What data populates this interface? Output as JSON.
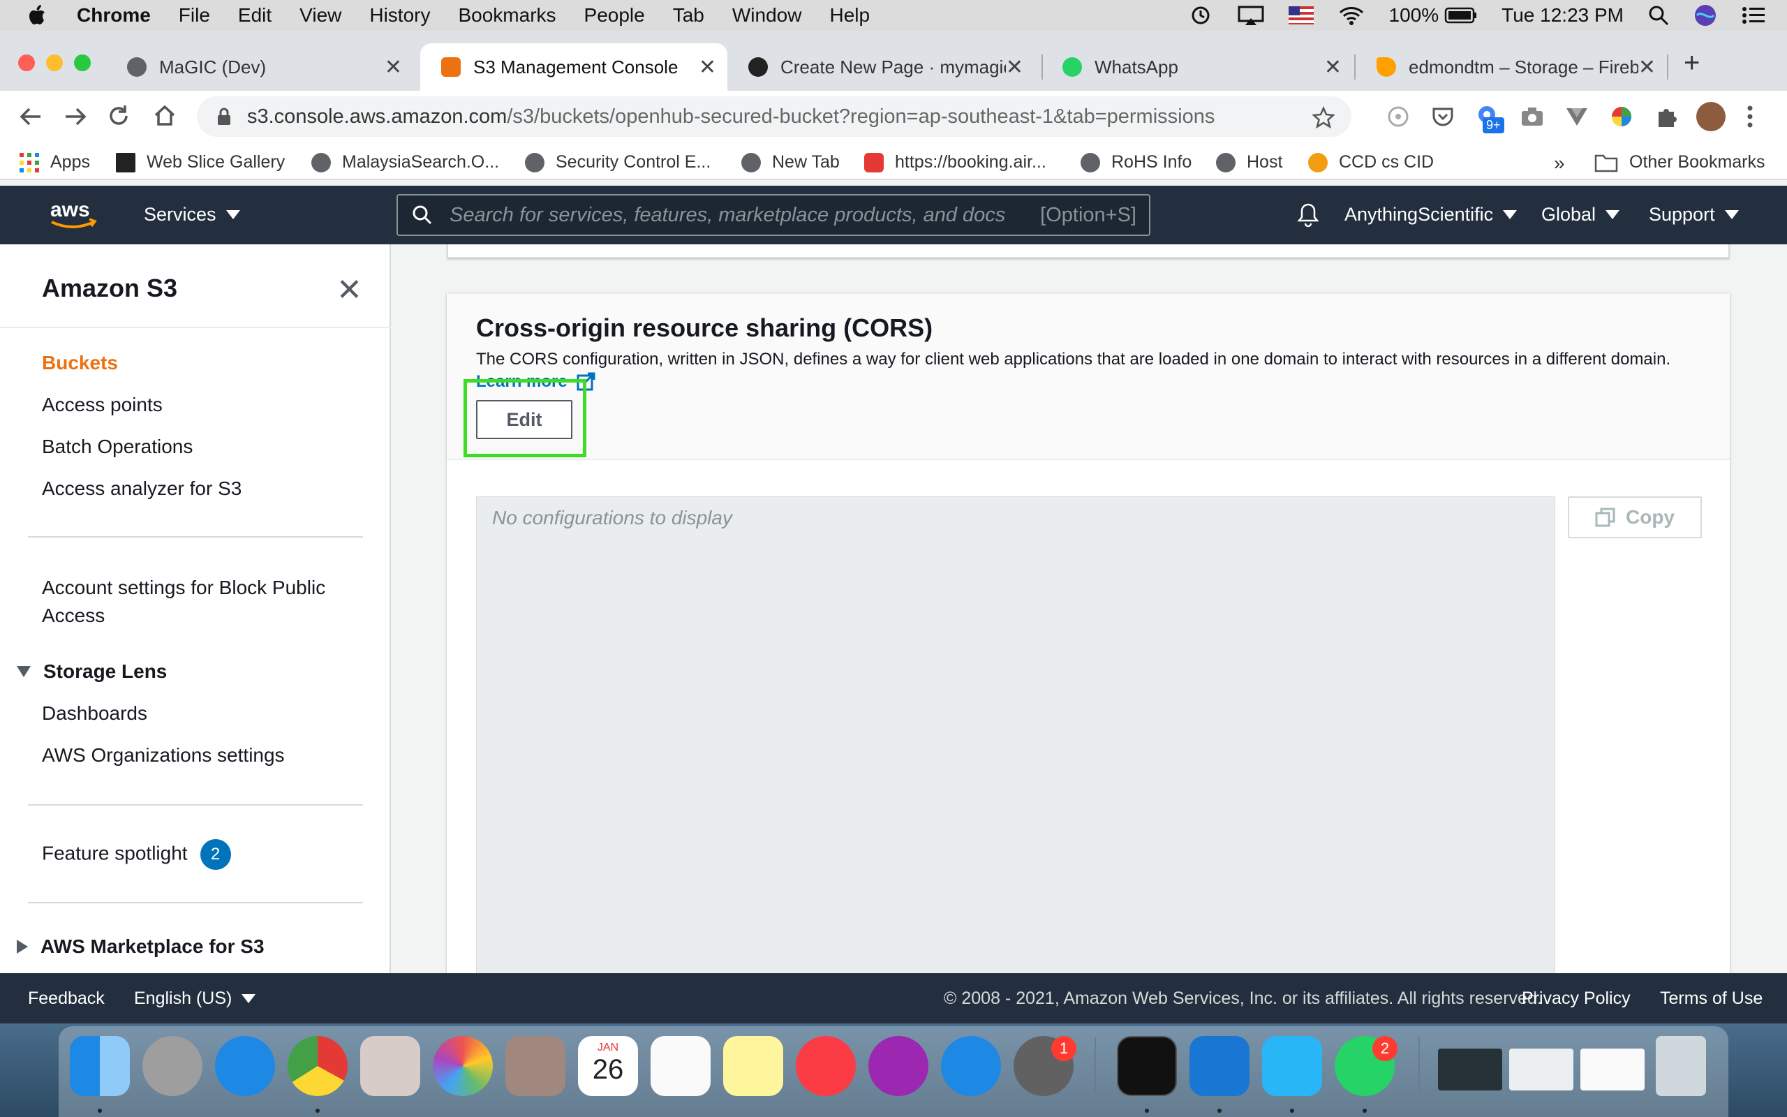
{
  "menubar": {
    "app_name": "Chrome",
    "items": [
      "File",
      "Edit",
      "View",
      "History",
      "Bookmarks",
      "People",
      "Tab",
      "Window",
      "Help"
    ],
    "battery": "100%",
    "clock": "Tue 12:23 PM"
  },
  "tabs": [
    {
      "title": "MaGIC (Dev)",
      "favicon": "globe-icon"
    },
    {
      "title": "S3 Management Console",
      "favicon": "aws-s3-icon"
    },
    {
      "title": "Create New Page · mymagic",
      "favicon": "github-icon"
    },
    {
      "title": "WhatsApp",
      "favicon": "whatsapp-icon"
    },
    {
      "title": "edmondtm – Storage – Fireb",
      "favicon": "firebase-icon"
    }
  ],
  "address_bar": {
    "host": "s3.console.aws.amazon.com",
    "path": "/s3/buckets/openhub-secured-bucket?region=ap-southeast-1&tab=permissions"
  },
  "extensions_badge": "9+",
  "bookmarks": [
    "Apps",
    "Web Slice Gallery",
    "MalaysiaSearch.O...",
    "Security Control E...",
    "New Tab",
    "https://booking.air...",
    "RoHS Info",
    "Host",
    "CCD cs CID"
  ],
  "bookmarks_overflow": "»",
  "other_bookmarks": "Other Bookmarks",
  "aws_header": {
    "services": "Services",
    "search_placeholder": "Search for services, features, marketplace products, and docs",
    "search_shortcut": "[Option+S]",
    "account": "AnythingScientific",
    "region": "Global",
    "support": "Support"
  },
  "sidebar": {
    "title": "Amazon S3",
    "items": [
      "Buckets",
      "Access points",
      "Batch Operations",
      "Access analyzer for S3"
    ],
    "account_settings": "Account settings for Block Public Access",
    "storage_lens": {
      "heading": "Storage Lens",
      "items": [
        "Dashboards",
        "AWS Organizations settings"
      ]
    },
    "feature_spotlight": "Feature spotlight",
    "feature_spotlight_count": "2",
    "marketplace": "AWS Marketplace for S3"
  },
  "cors": {
    "title": "Cross-origin resource sharing (CORS)",
    "description": "The CORS configuration, written in JSON, defines a way for client web applications that are loaded in one domain to interact with resources in a different domain.",
    "learn_more": "Learn more",
    "edit_label": "Edit",
    "empty_text": "No configurations to display",
    "copy_label": "Copy"
  },
  "footer": {
    "feedback": "Feedback",
    "language": "English (US)",
    "copyright": "© 2008 - 2021, Amazon Web Services, Inc. or its affiliates. All rights reserved.",
    "privacy": "Privacy Policy",
    "terms": "Terms of Use"
  },
  "dock": {
    "calendar_month": "JAN",
    "calendar_day": "26",
    "system_prefs_badge": "1",
    "whatsapp_badge": "2"
  },
  "colors": {
    "aws_nav": "#232f3e",
    "aws_orange": "#ec7211",
    "link_blue": "#0073bb",
    "highlight_green": "#3edc23"
  }
}
